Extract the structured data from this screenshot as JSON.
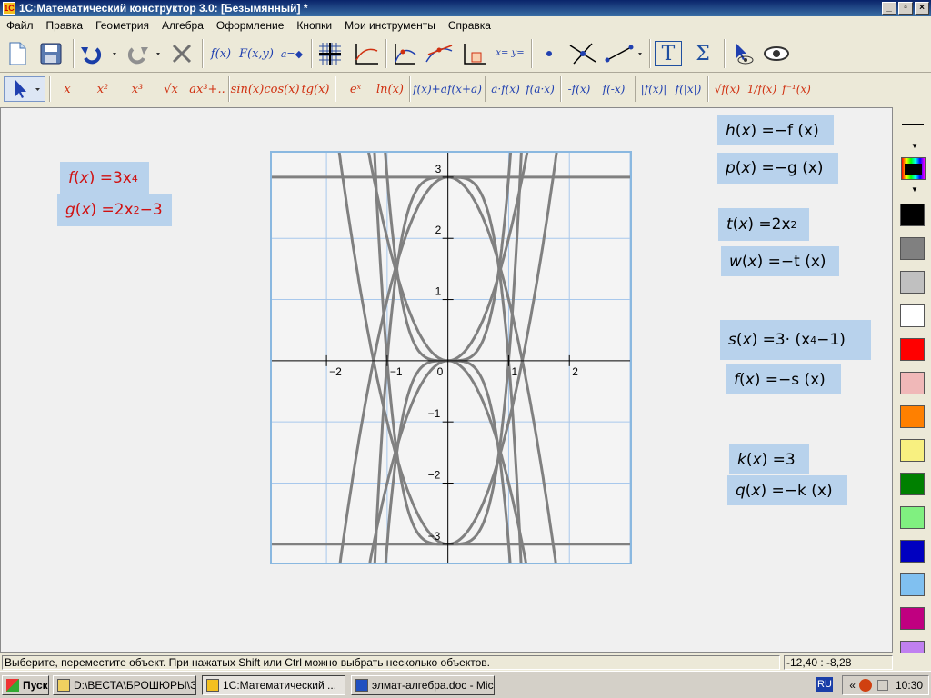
{
  "window": {
    "title": "1С:Математический конструктор 3.0: [Безымянный] *"
  },
  "menu": [
    "Файл",
    "Правка",
    "Геометрия",
    "Алгебра",
    "Оформление",
    "Кнопки",
    "Мои инструменты",
    "Справка"
  ],
  "toolbar1": [
    {
      "name": "new-doc-icon"
    },
    {
      "name": "save-icon"
    },
    {
      "name": "undo-icon"
    },
    {
      "name": "redo-icon"
    },
    {
      "name": "delete-icon"
    },
    {
      "name": "function-button",
      "label": "f(x)"
    },
    {
      "name": "implicit-function-button",
      "label": "F(x,y)"
    },
    {
      "name": "parameter-button",
      "label": "a="
    },
    {
      "name": "grid-icon"
    },
    {
      "name": "axes-icon"
    },
    {
      "name": "graph-point-icon"
    },
    {
      "name": "tangent-icon"
    },
    {
      "name": "integral-icon"
    },
    {
      "name": "coordinates-button",
      "label": "x= y="
    },
    {
      "name": "point-icon"
    },
    {
      "name": "intersection-icon"
    },
    {
      "name": "segment-icon"
    },
    {
      "name": "text-tool-icon",
      "label": "T"
    },
    {
      "name": "sum-tool-icon",
      "label": "Σ"
    },
    {
      "name": "select-view-icon"
    },
    {
      "name": "eye-icon"
    }
  ],
  "toolbar2": [
    "x",
    "x²",
    "x³",
    "√x",
    "ax³+..",
    "sin(x)",
    "cos(x)",
    "tg(x)",
    "eˣ",
    "ln(x)",
    "f(x)+a",
    "f(x+a)",
    "a·f(x)",
    "f(a·x)",
    "-f(x)",
    "f(-x)",
    "|f(x)|",
    "f(|x|)",
    "√f(x)",
    "1/f(x)",
    "f⁻¹(x)"
  ],
  "formulas": {
    "f1": {
      "name": "f",
      "rhs": "3x",
      "exp": "4",
      "tail": ""
    },
    "g": {
      "name": "g",
      "rhs": "2x",
      "exp": "2",
      "tail": "−3"
    },
    "h": {
      "name": "h",
      "rhs": "−f (x)"
    },
    "p": {
      "name": "p",
      "rhs": "−g (x)"
    },
    "t": {
      "name": "t",
      "rhs": "2x",
      "exp": "2"
    },
    "w": {
      "name": "w",
      "rhs": "−t (x)"
    },
    "s": {
      "name": "s",
      "rhs": "3·  (x",
      "exp": "4",
      "tail": "−1)"
    },
    "f2": {
      "name": "f",
      "rhs": "−s (x)"
    },
    "k": {
      "name": "k",
      "rhs": "3"
    },
    "q": {
      "name": "q",
      "rhs": "−k (x)"
    }
  },
  "plot": {
    "x_ticks": [
      "−2",
      "−1",
      "0",
      "1",
      "2"
    ],
    "y_ticks": [
      "3",
      "2",
      "1",
      "−1",
      "−2",
      "−3"
    ],
    "xlim": [
      -2.9,
      3.0
    ],
    "ylim": [
      -3.3,
      3.4
    ],
    "curves": [
      "3x^4",
      "-3x^4",
      "2x^2-3",
      "3-2x^2",
      "2x^2",
      "-2x^2",
      "3(x^4-1)",
      "-3(x^4-1)",
      "3",
      "-3"
    ],
    "curve_color": "#808080"
  },
  "palette": {
    "colors": [
      "#000000",
      "#808080",
      "#c0c0c0",
      "#ffffff",
      "#ff0000",
      "#f0b8b8",
      "#ff8000",
      "#f8f080",
      "#008000",
      "#80f080",
      "#0000c0",
      "#80c0f0",
      "#c00080",
      "#c080f0"
    ]
  },
  "status": {
    "message": "Выберите, переместите объект. При нажатых Shift или Ctrl можно выбрать несколько объектов.",
    "coords": "-12,40 : -8,28"
  },
  "taskbar": {
    "start": "Пуск",
    "items": [
      "D:\\ВЕСТА\\БРОШЮРЫ\\Э...",
      "1С:Математический ...",
      "элмат-алгебра.doc - Mic..."
    ],
    "lang": "RU",
    "tray_arrows": "«",
    "clock": "10:30"
  }
}
